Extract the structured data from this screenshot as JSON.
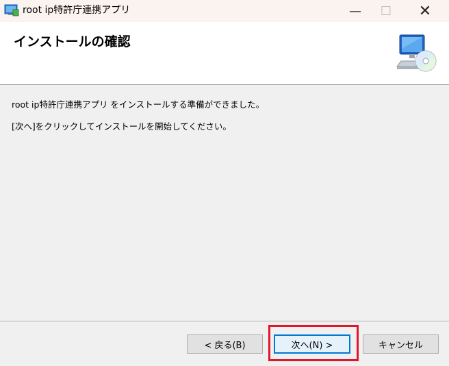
{
  "window": {
    "title": "root ip特許庁連携アプリ",
    "minimize": "—",
    "maximize": "☐",
    "close": "✕"
  },
  "header": {
    "title": "インストールの確認",
    "graphic": "computer-cd-icon"
  },
  "content": {
    "line1": "root ip特許庁連携アプリ をインストールする準備ができました。",
    "line2": "[次へ]をクリックしてインストールを開始してください。"
  },
  "buttons": {
    "back": "< 戻る(B)",
    "next": "次へ(N) >",
    "cancel": "キャンセル"
  },
  "colors": {
    "highlight": "#e0162b",
    "accent": "#0078d7"
  }
}
